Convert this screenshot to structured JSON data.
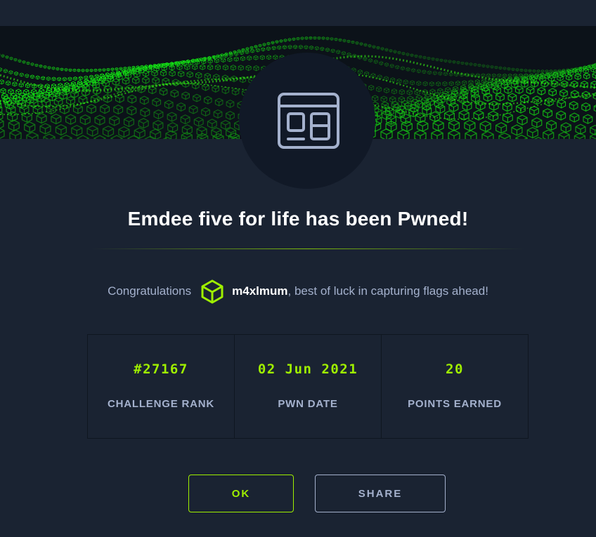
{
  "modal": {
    "title": "Emdee five for life has been Pwned!",
    "congrats_prefix": "Congratulations",
    "username": "m4xlmum",
    "congrats_suffix": ", best of luck in capturing flags ahead!",
    "badge_icon": "browser-window-icon",
    "user_icon": "hexagon-cube-icon"
  },
  "stats": [
    {
      "value": "#27167",
      "label": "CHALLENGE RANK"
    },
    {
      "value": "02 Jun 2021",
      "label": "PWN DATE"
    },
    {
      "value": "20",
      "label": "POINTS EARNED"
    }
  ],
  "buttons": {
    "ok": "OK",
    "share": "SHARE"
  },
  "colors": {
    "background": "#1a2332",
    "accent": "#9fef00",
    "muted_text": "#a4b1cd",
    "badge_bg": "#111927"
  }
}
